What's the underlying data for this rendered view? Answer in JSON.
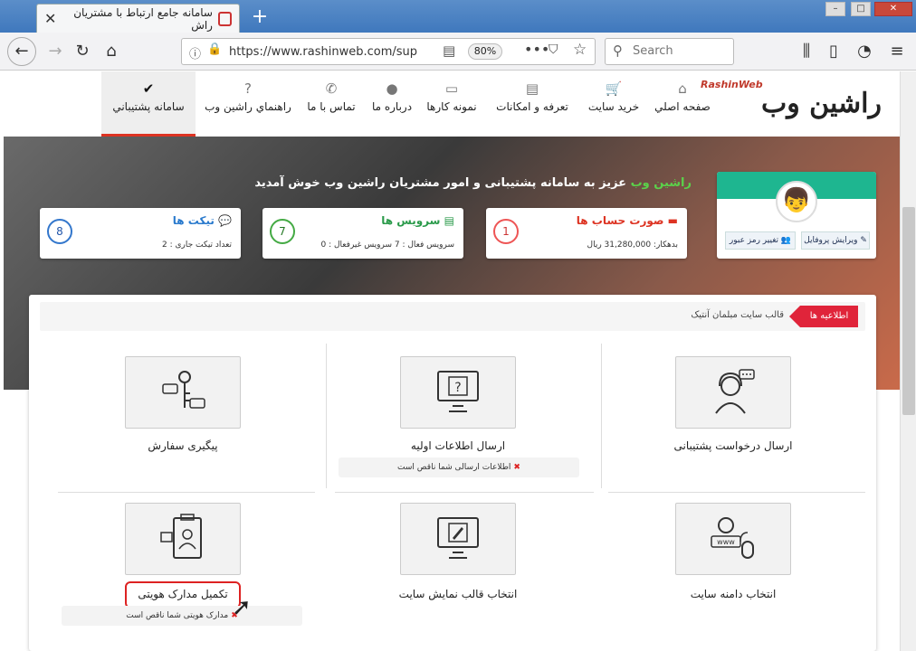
{
  "browser": {
    "tab_title": "سامانه جامع ارتباط با مشتریان راش",
    "tab_close": "✕",
    "new_tab": "+",
    "url": "https://www.rashinweb.com/sup",
    "zoom": "80%",
    "search_placeholder": "Search"
  },
  "site": {
    "logo_main": "راشین وب",
    "logo_en": "RashinWeb",
    "menu": [
      {
        "label": "صفحه اصلي",
        "icon": "home-icon"
      },
      {
        "label": "خرید سایت",
        "icon": "cart-icon"
      },
      {
        "label": "تعرفه و امکانات",
        "icon": "server-icon"
      },
      {
        "label": "نمونه کارها",
        "icon": "laptop-icon"
      },
      {
        "label": "درباره ما",
        "icon": "globe-icon"
      },
      {
        "label": "تماس با ما",
        "icon": "phone-icon"
      },
      {
        "label": "راهنماي راشين وب",
        "icon": "question-icon"
      },
      {
        "label": "سامانه پشتيباني",
        "icon": "check-circle-icon"
      }
    ]
  },
  "hero": {
    "welcome_name": "راشین وب",
    "welcome_text": " عزیز به سامانه پشتیبانی و امور مشتریان راشین وب خوش آمدید"
  },
  "profile": {
    "edit_label": "ویرایش پروفایل",
    "password_label": "تغییر رمز عبور"
  },
  "stats": {
    "invoice": {
      "title": "صورت حساب ها",
      "line": "بدهکار: 31,280,000 ریال",
      "count": "1"
    },
    "service": {
      "title": "سرویس ها",
      "line": "سرویس فعال : 7     سرویس غیرفعال : 0",
      "count": "7"
    },
    "ticket": {
      "title": "تیکت ها",
      "line": "تعداد تیکت جاری : 2",
      "count": "8"
    }
  },
  "news": {
    "label": "اطلاعیه ها",
    "text": "قالب سایت مبلمان آنتیک"
  },
  "tiles": [
    {
      "label": "ارسال درخواست پشتیبانی",
      "icon": "support-agent-icon"
    },
    {
      "label": "ارسال اطلاعات اولیه",
      "icon": "monitor-question-icon",
      "warning": "اطلاعات ارسالی شما ناقص است"
    },
    {
      "label": "پیگیری سفارش",
      "icon": "key-chat-icon"
    },
    {
      "label": "انتخاب دامنه سایت",
      "icon": "www-mouse-icon"
    },
    {
      "label": "انتخاب قالب نمایش سایت",
      "icon": "monitor-pen-icon"
    },
    {
      "label": "تکمیل مدارک هویتی",
      "icon": "id-clipboard-icon",
      "warning": "مدارک هویتی شما ناقص است"
    }
  ],
  "colors": {
    "accent": "#d32f2f",
    "teal": "#1eb690",
    "green": "#2a9a4a",
    "blue": "#2a7acd"
  }
}
